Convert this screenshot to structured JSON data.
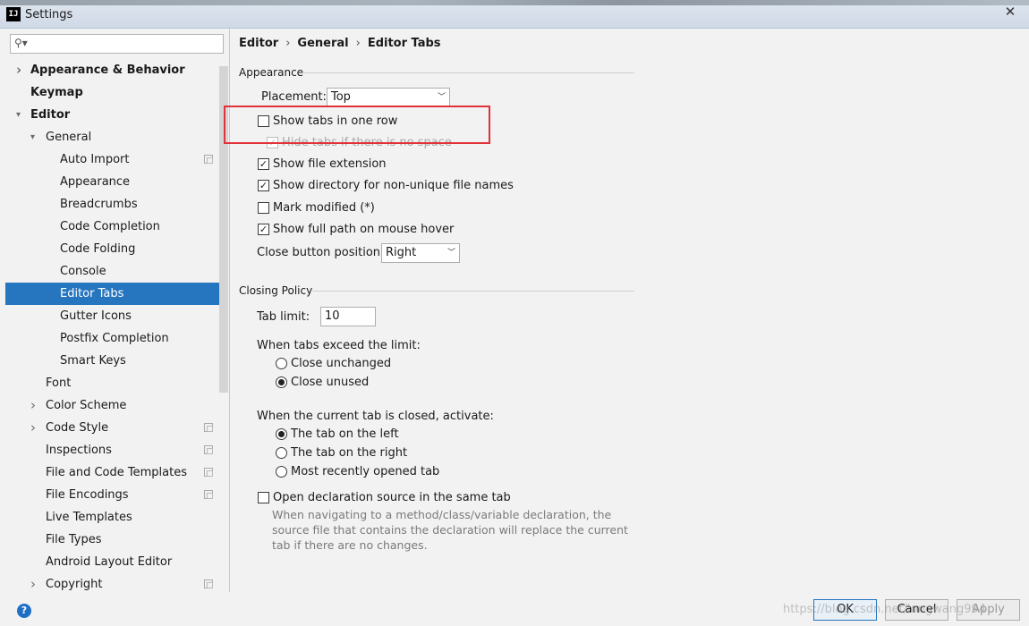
{
  "window": {
    "title": "Settings",
    "app_icon": "IJ",
    "close": "✕"
  },
  "search": {
    "placeholder": "",
    "icon": "search-icon"
  },
  "tree": [
    {
      "label": "Appearance & Behavior",
      "level": 0,
      "arrow": "collapsed",
      "bold": true
    },
    {
      "label": "Keymap",
      "level": 0,
      "arrow": "none",
      "bold": true
    },
    {
      "label": "Editor",
      "level": 0,
      "arrow": "expanded",
      "bold": true
    },
    {
      "label": "General",
      "level": 1,
      "arrow": "expanded"
    },
    {
      "label": "Auto Import",
      "level": 2,
      "copy_icon": true
    },
    {
      "label": "Appearance",
      "level": 2
    },
    {
      "label": "Breadcrumbs",
      "level": 2
    },
    {
      "label": "Code Completion",
      "level": 2
    },
    {
      "label": "Code Folding",
      "level": 2
    },
    {
      "label": "Console",
      "level": 2
    },
    {
      "label": "Editor Tabs",
      "level": 2,
      "selected": true
    },
    {
      "label": "Gutter Icons",
      "level": 2
    },
    {
      "label": "Postfix Completion",
      "level": 2
    },
    {
      "label": "Smart Keys",
      "level": 2
    },
    {
      "label": "Font",
      "level": 1
    },
    {
      "label": "Color Scheme",
      "level": 1,
      "arrow": "collapsed"
    },
    {
      "label": "Code Style",
      "level": 1,
      "arrow": "collapsed",
      "copy_icon": true
    },
    {
      "label": "Inspections",
      "level": 1,
      "copy_icon": true
    },
    {
      "label": "File and Code Templates",
      "level": 1,
      "copy_icon": true
    },
    {
      "label": "File Encodings",
      "level": 1,
      "copy_icon": true
    },
    {
      "label": "Live Templates",
      "level": 1
    },
    {
      "label": "File Types",
      "level": 1
    },
    {
      "label": "Android Layout Editor",
      "level": 1
    },
    {
      "label": "Copyright",
      "level": 1,
      "arrow": "collapsed",
      "copy_icon": true
    }
  ],
  "breadcrumb": [
    "Editor",
    "General",
    "Editor Tabs"
  ],
  "breadcrumb_sep": "›",
  "appearance": {
    "title": "Appearance",
    "placement_label": "Placement:",
    "placement_value": "Top",
    "show_tabs_one_row": {
      "label": "Show tabs in one row",
      "checked": false
    },
    "hide_tabs_no_space": {
      "label": "Hide tabs if there is no space",
      "checked": true,
      "disabled": true
    },
    "show_file_extension": {
      "label": "Show file extension",
      "checked": true
    },
    "show_directory": {
      "label": "Show directory for non-unique file names",
      "checked": true
    },
    "mark_modified": {
      "label": "Mark modified (*)",
      "checked": false
    },
    "show_full_path": {
      "label": "Show full path on mouse hover",
      "checked": true
    },
    "close_button_label": "Close button position:",
    "close_button_value": "Right"
  },
  "closing_policy": {
    "title": "Closing Policy",
    "tab_limit_label": "Tab limit:",
    "tab_limit_value": "10",
    "exceed_label": "When tabs exceed the limit:",
    "exceed_options": [
      {
        "label": "Close unchanged",
        "selected": false
      },
      {
        "label": "Close unused",
        "selected": true
      }
    ],
    "activate_label": "When the current tab is closed, activate:",
    "activate_options": [
      {
        "label": "The tab on the left",
        "selected": true
      },
      {
        "label": "The tab on the right",
        "selected": false
      },
      {
        "label": "Most recently opened tab",
        "selected": false
      }
    ],
    "open_declaration": {
      "label": "Open declaration source in the same tab",
      "checked": false
    },
    "open_declaration_help": "When navigating to a method/class/variable declaration, the source file that contains the declaration will replace the current tab if there are no changes."
  },
  "buttons": {
    "help": "?",
    "ok": "OK",
    "cancel": "Cancel",
    "apply": "Apply"
  },
  "watermark": "https://blog.csdn.net/longwang994",
  "colors": {
    "selection": "#2675bf",
    "highlight": "#e0323a"
  }
}
